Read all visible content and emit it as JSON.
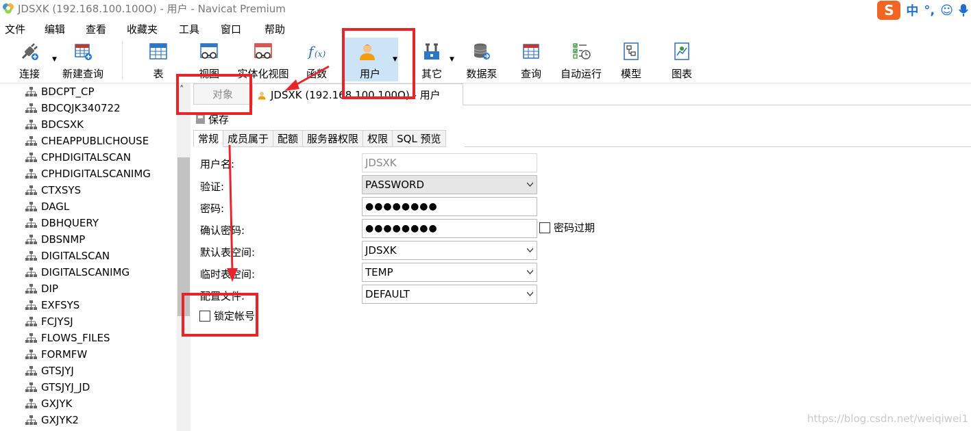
{
  "window": {
    "title": "JDSXK (192.168.100.100O) - 用户 - Navicat Premium"
  },
  "ime": {
    "logo": "S",
    "items": [
      "中",
      "°,",
      "☺",
      "🎤"
    ]
  },
  "menu": [
    "文件",
    "编辑",
    "查看",
    "收藏夹",
    "工具",
    "窗口",
    "帮助"
  ],
  "toolbar": {
    "connect": "连接",
    "new_query": "新建查询",
    "table": "表",
    "view": "视图",
    "materialized_view": "实体化视图",
    "function": "函数",
    "user": "用户",
    "other": "其它",
    "data_pump": "数据泵",
    "query": "查询",
    "automation": "自动运行",
    "model": "模型",
    "chart": "图表"
  },
  "sidebar": {
    "items": [
      "BDCPT_CP",
      "BDCQJK340722",
      "BDCSXK",
      "CHEAPPUBLICHOUSE",
      "CPHDIGITALSCAN",
      "CPHDIGITALSCANIMG",
      "CTXSYS",
      "DAGL",
      "DBHQUERY",
      "DBSNMP",
      "DIGITALSCAN",
      "DIGITALSCANIMG",
      "DIP",
      "EXFSYS",
      "FCJYSJ",
      "FLOWS_FILES",
      "FORMFW",
      "GTSJYJ",
      "GTSJYJ_JD",
      "GXJYK",
      "GXJYK2"
    ]
  },
  "tabs": {
    "objects": "对象",
    "user_tab": "JDSXK (192.168.100.100O) - 用户"
  },
  "editor": {
    "save": "保存",
    "subtabs": [
      "常规",
      "成员属于",
      "配额",
      "服务器权限",
      "权限",
      "SQL 预览"
    ],
    "fields": {
      "username_label": "用户名:",
      "username_value": "JDSXK",
      "auth_label": "验证:",
      "auth_value": "PASSWORD",
      "password_label": "密码:",
      "password_value": "●●●●●●●●",
      "confirm_label": "确认密码:",
      "confirm_value": "●●●●●●●●",
      "password_expired": "密码过期",
      "default_ts_label": "默认表空间:",
      "default_ts_value": "JDSXK",
      "temp_ts_label": "临时表空间:",
      "temp_ts_value": "TEMP",
      "profile_label": "配置文件:",
      "profile_value": "DEFAULT",
      "lock_account": "锁定帐号"
    }
  },
  "watermark": "https://blog.csdn.net/weiqiwei1",
  "colors": {
    "annotation_red": "#e8242b",
    "active_tool_bg": "#cde4f7"
  }
}
